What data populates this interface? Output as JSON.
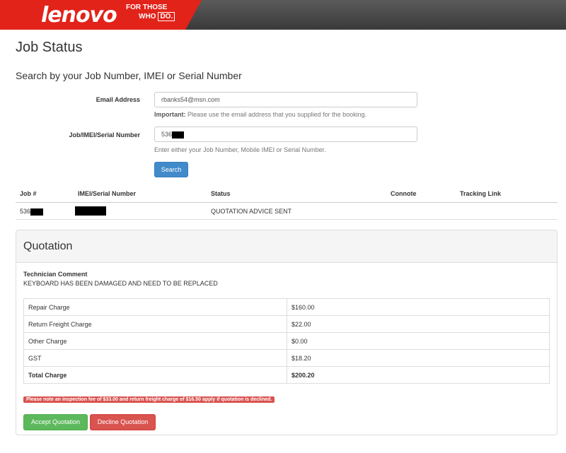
{
  "header": {
    "logo_text": "lenovo",
    "tagline_1": "FOR THOSE",
    "tagline_2": "WHO",
    "tagline_box": "DO."
  },
  "colors": {
    "brand_red": "#e2231a",
    "primary": "#428bca",
    "success": "#5cb85c",
    "danger": "#d9534f"
  },
  "page": {
    "title": "Job Status",
    "subtitle": "Search by your Job Number, IMEI or Serial Number"
  },
  "form": {
    "email_label": "Email Address",
    "email_value": "rbanks54@msn.com",
    "email_help_strong": "Important:",
    "email_help_text": " Please use the email address that you supplied for the booking.",
    "job_label": "Job/IMEI/Serial Number",
    "job_value_visible": "536",
    "job_help": "Enter either your Job Number, Mobile IMEI or Serial Number.",
    "search_label": "Search"
  },
  "results": {
    "headers": [
      "Job #",
      "IMEI/Serial Number",
      "Status",
      "Connote",
      "Tracking Link"
    ],
    "row": {
      "job_visible": "536",
      "status": "QUOTATION ADVICE SENT"
    }
  },
  "quotation": {
    "title": "Quotation",
    "tech_comment_label": "Technician Comment",
    "tech_comment": "KEYBOARD HAS BEEN DAMAGED AND NEED TO BE REPLACED",
    "rows": [
      {
        "label": "Repair Charge",
        "value": "$160.00"
      },
      {
        "label": "Return Freight Charge",
        "value": "$22.00"
      },
      {
        "label": "Other Charge",
        "value": "$0.00"
      },
      {
        "label": "GST",
        "value": "$18.20"
      },
      {
        "label": "Total Charge",
        "value": "$200.20"
      }
    ],
    "note": "Please note an inspection fee of $33.00 and return freight charge of $16.50 apply if quotation is declined.",
    "accept_label": "Accept Quotation",
    "decline_label": "Decline Quotation"
  }
}
